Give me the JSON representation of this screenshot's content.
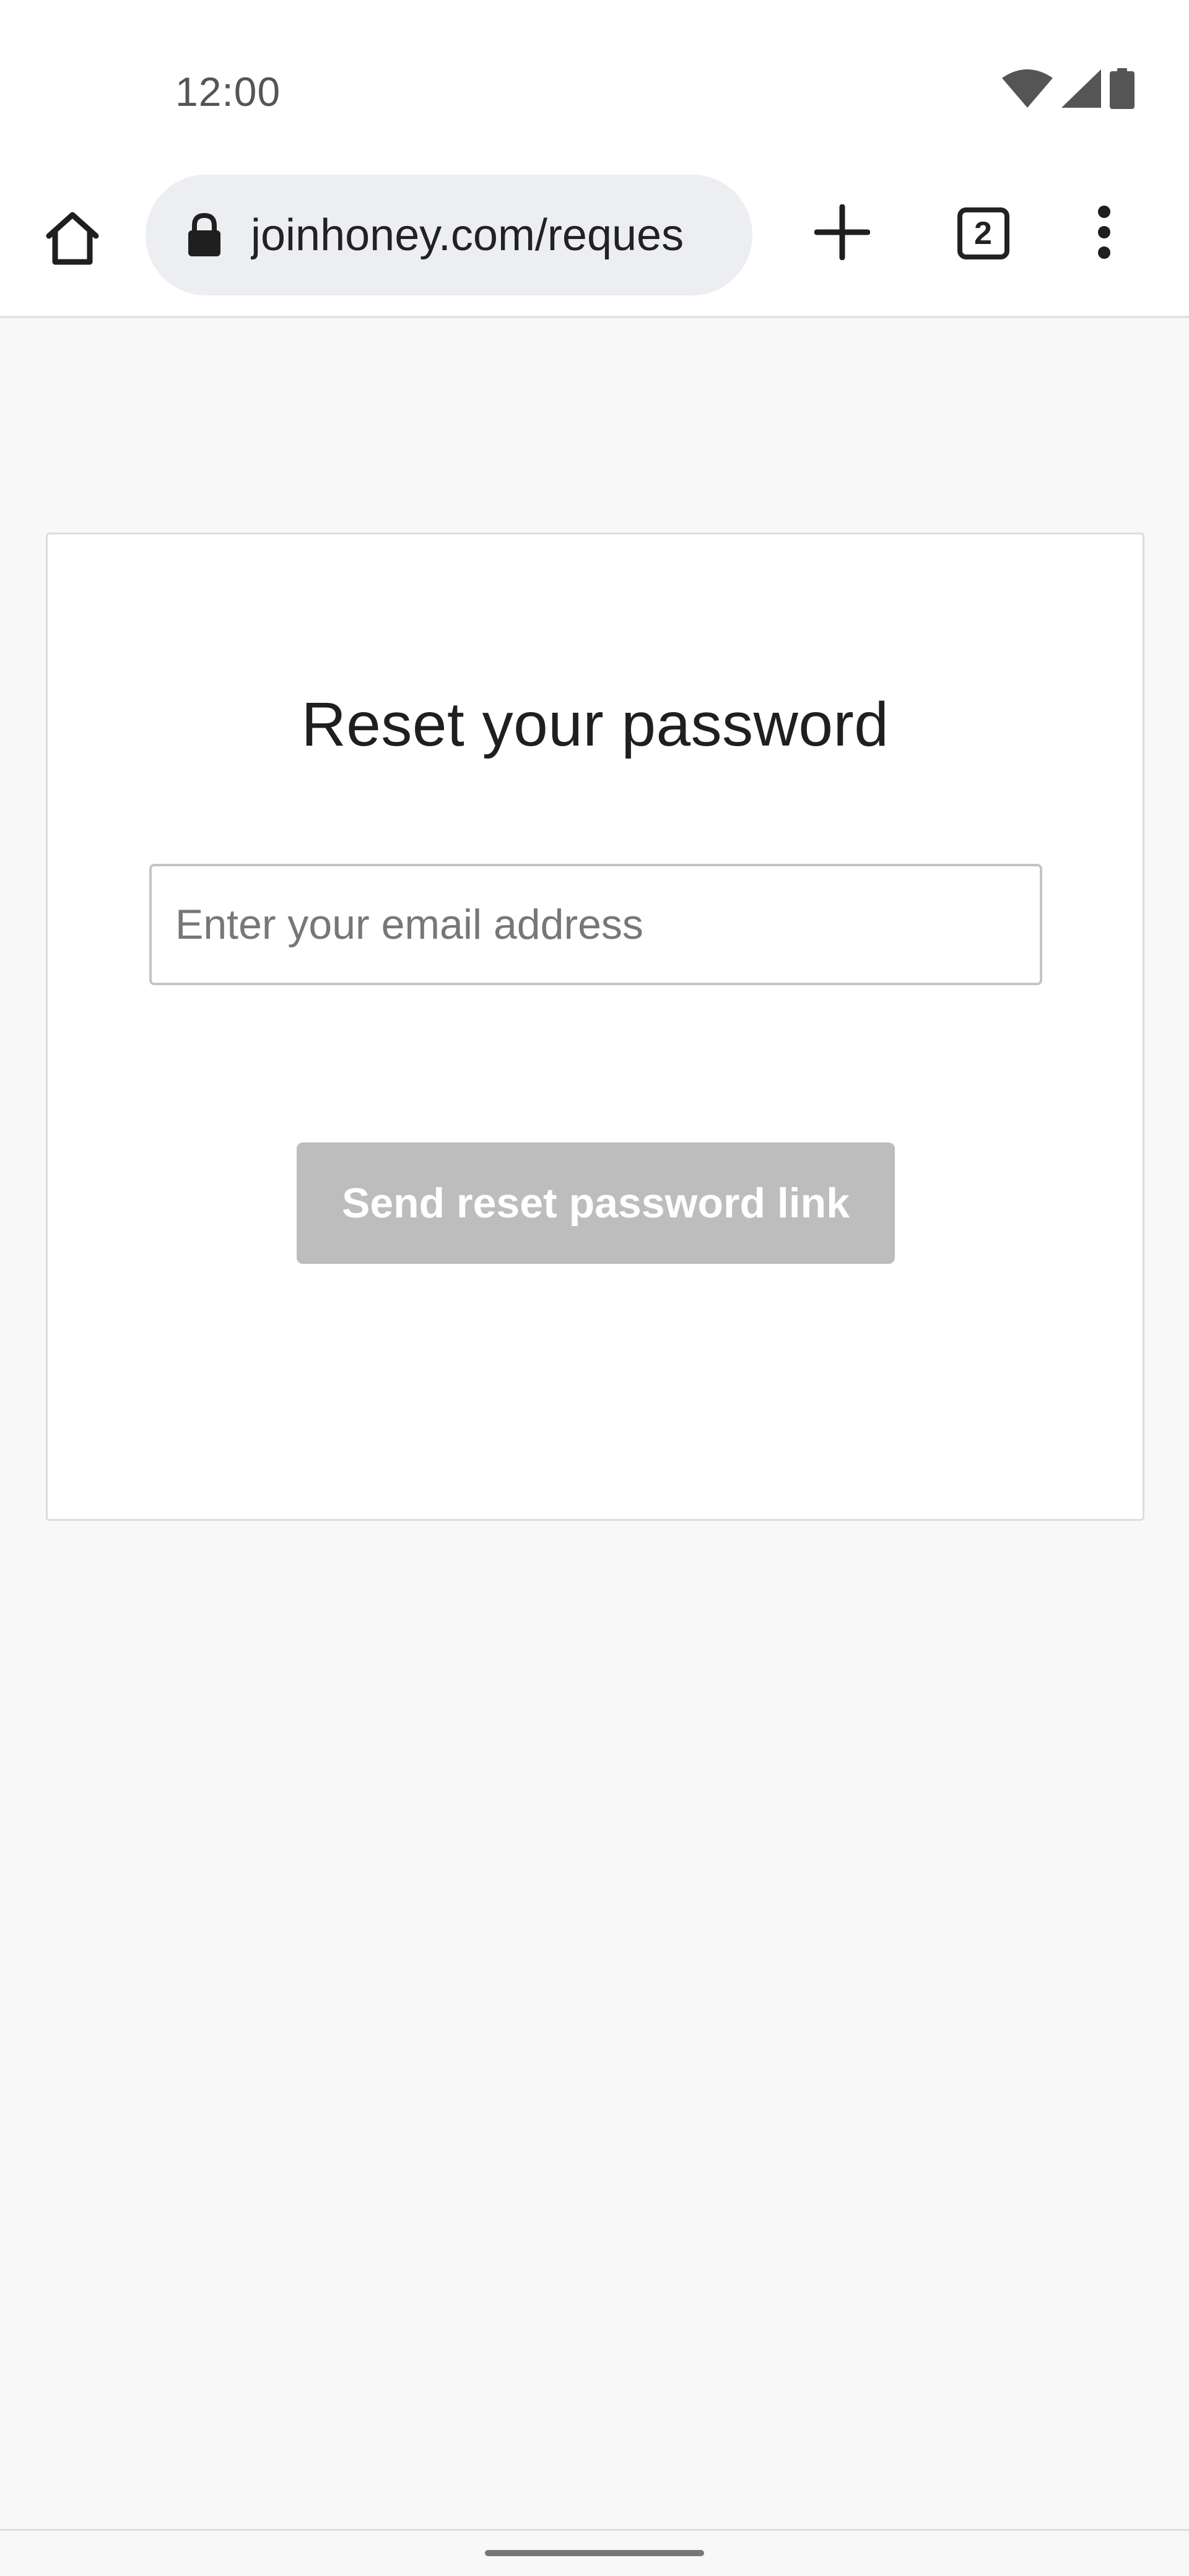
{
  "status_bar": {
    "time": "12:00",
    "icons": [
      "wifi-icon",
      "signal-icon",
      "battery-icon"
    ]
  },
  "browser": {
    "url": "joinhoney.com/reques",
    "tab_count": "2",
    "icons": [
      "home-icon",
      "lock-icon",
      "plus-icon",
      "more-vert-icon"
    ]
  },
  "form": {
    "title": "Reset your password",
    "email_placeholder": "Enter your email address",
    "email_value": "",
    "submit_label": "Send reset password link"
  },
  "colors": {
    "page_background": "#f8f8f8",
    "button_disabled": "#bdbdbd",
    "button_text": "#ffffff"
  }
}
